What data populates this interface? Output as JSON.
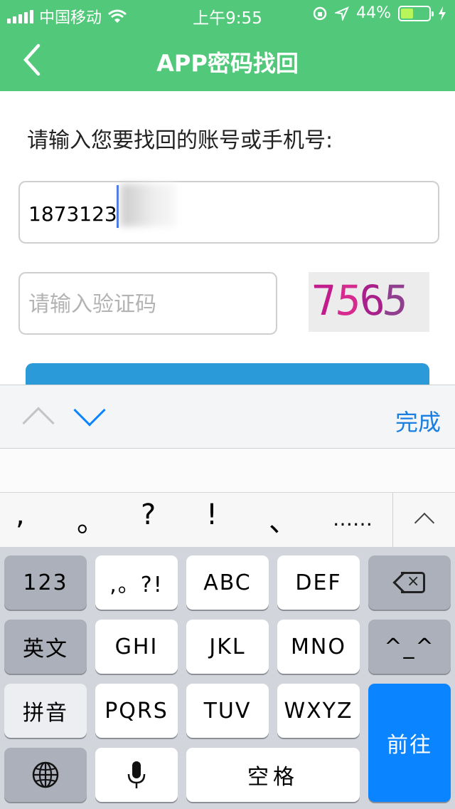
{
  "status_bar": {
    "carrier": "中国移动",
    "time": "上午9:55",
    "battery_text": "44%",
    "battery_level": 0.44
  },
  "nav": {
    "title": "APP密码找回"
  },
  "form": {
    "prompt": "请输入您要找回的账号或手机号:",
    "phone_value": "1873123",
    "code_placeholder": "请输入验证码",
    "captcha": "7565"
  },
  "accessory": {
    "done_label": "完成"
  },
  "punctuation": [
    ",",
    "。",
    "?",
    "!",
    "、",
    "……"
  ],
  "keyboard": {
    "row1": [
      "123",
      ",。?!",
      "ABC",
      "DEF"
    ],
    "row2": [
      "英文",
      "GHI",
      "JKL",
      "MNO",
      "^_^"
    ],
    "row3": [
      "拼音",
      "PQRS",
      "TUV",
      "WXYZ"
    ],
    "go_label": "前往",
    "space_label": "空格"
  }
}
